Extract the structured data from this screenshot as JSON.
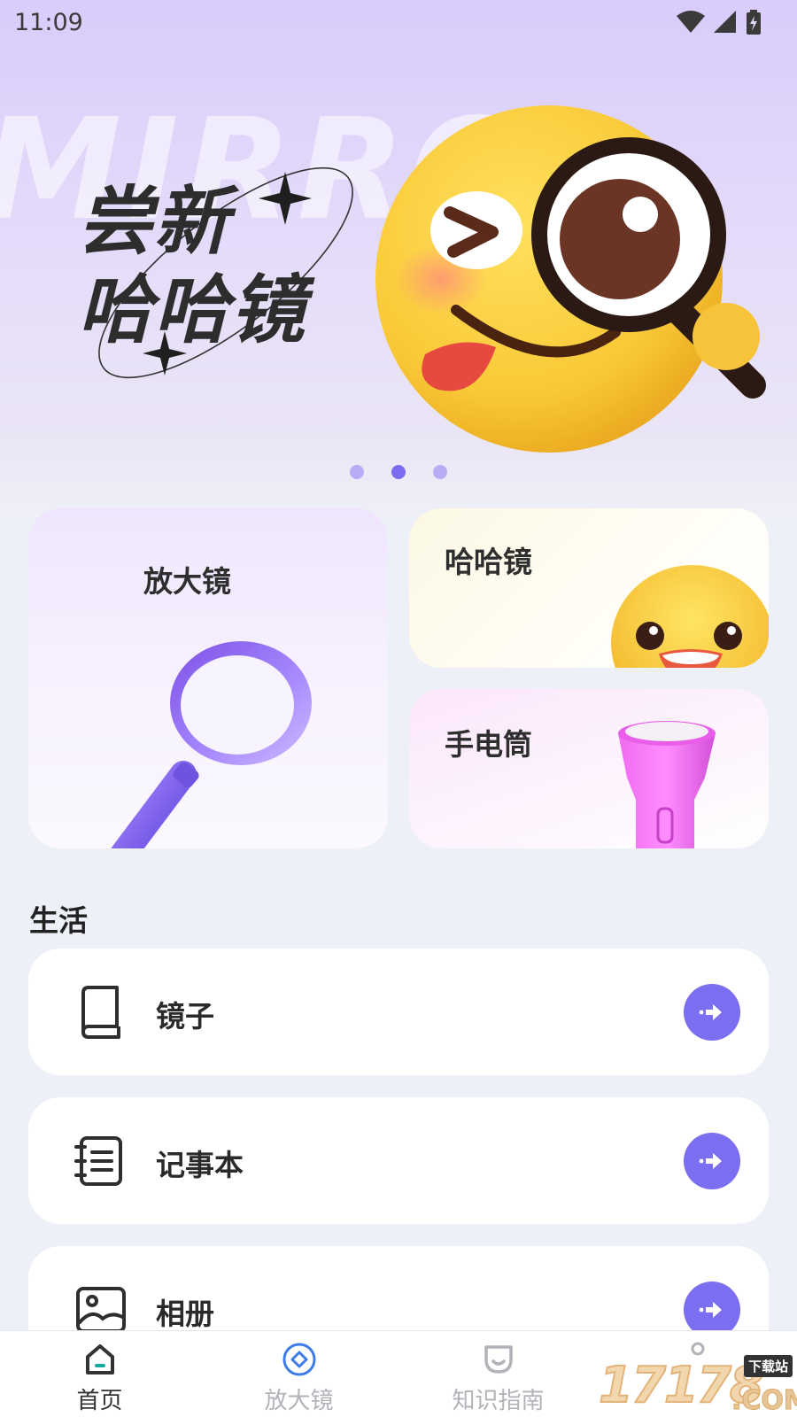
{
  "status_bar": {
    "time": "11:09"
  },
  "banner": {
    "bg_word": "MIRROR",
    "title_line1": "尝新",
    "title_line2": "哈哈镜",
    "dots": 3,
    "active_dot": 1
  },
  "features": {
    "magnifier": {
      "label": "放大镜"
    },
    "funhouse": {
      "label": "哈哈镜"
    },
    "flashlight": {
      "label": "手电筒"
    }
  },
  "life": {
    "title": "生活",
    "items": [
      {
        "label": "镜子",
        "icon": "book-icon"
      },
      {
        "label": "记事本",
        "icon": "notebook-icon"
      },
      {
        "label": "相册",
        "icon": "image-icon"
      }
    ]
  },
  "nav": {
    "items": [
      {
        "label": "首页",
        "icon": "home-icon"
      },
      {
        "label": "放大镜",
        "icon": "diamond-icon"
      },
      {
        "label": "知识指南",
        "icon": "guide-icon"
      }
    ]
  },
  "watermark": {
    "text": "17178",
    "badge": "下载站",
    "suffix": ".COM"
  },
  "colors": {
    "accent": "#7b6ef1",
    "banner_bg": "#d9ccfb",
    "page_bg": "#eef0f7",
    "nav_active_icon": "#1aa9a0",
    "nav_blue": "#3d7be8"
  }
}
